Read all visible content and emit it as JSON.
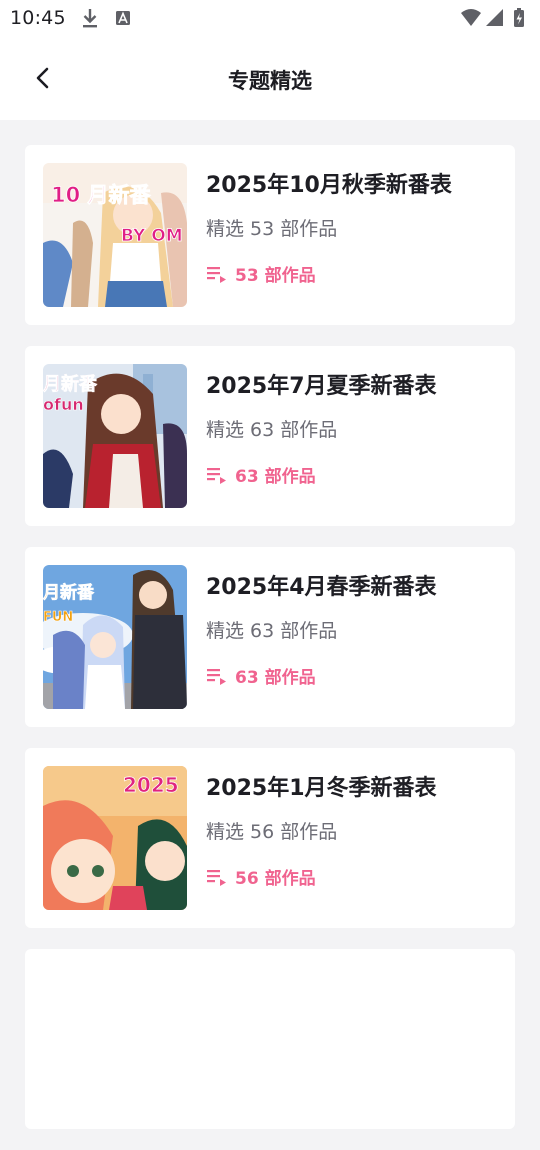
{
  "status_bar": {
    "time": "10:45",
    "icons": [
      "download-icon",
      "font-icon",
      "wifi-icon",
      "signal-icon",
      "battery-charging-icon"
    ]
  },
  "header": {
    "title": "专题精选",
    "back_icon": "chevron-left-icon"
  },
  "colors": {
    "accent": "#f0638f",
    "background": "#f3f3f5",
    "card": "#ffffff",
    "title_text": "#1e1e24",
    "sub_text": "#6d6d76"
  },
  "topics": [
    {
      "title": "2025年10月秋季新番表",
      "subtitle": "精选 53 部作品",
      "count_label": "53 部作品",
      "cover_text": [
        "10 月新番",
        "BY OM"
      ]
    },
    {
      "title": "2025年7月夏季新番表",
      "subtitle": "精选 63 部作品",
      "count_label": "63 部作品",
      "cover_text": [
        "月新番",
        "ofun"
      ]
    },
    {
      "title": "2025年4月春季新番表",
      "subtitle": "精选 63 部作品",
      "count_label": "63 部作品",
      "cover_text": [
        "月新番",
        "FUN"
      ]
    },
    {
      "title": "2025年1月冬季新番表",
      "subtitle": "精选 56 部作品",
      "count_label": "56 部作品",
      "cover_text": [
        "2025"
      ]
    }
  ]
}
